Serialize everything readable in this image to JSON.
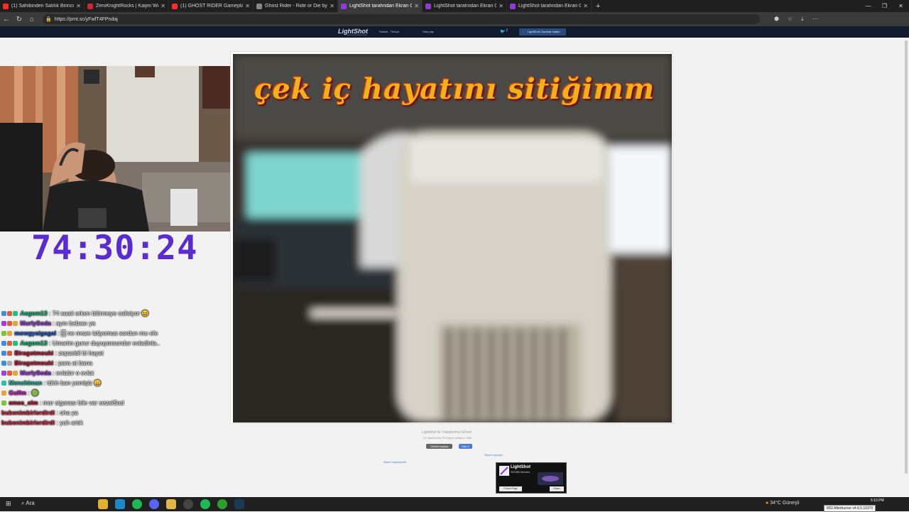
{
  "browser": {
    "tabs": [
      {
        "title": "(1) Sahibinden Satılık Birinci El Ot",
        "color": "#ff2b2b"
      },
      {
        "title": "ZeroKnightRocks | Kaijini Wiki | Fa",
        "color": "#d3243b"
      },
      {
        "title": "(1) GHOST RIDER Gameplay Walk",
        "color": "#ff2b2b"
      },
      {
        "title": "Ghost Rider - Ride or Die by Mag",
        "color": "#888888"
      },
      {
        "title": "LightShot tarafından Ekran Görün",
        "color": "#8f3bd6",
        "active": true
      },
      {
        "title": "LightShot tarafından Ekran Görün",
        "color": "#8f3bd6"
      },
      {
        "title": "LightShot tarafından Ekran Görün",
        "color": "#8f3bd6"
      }
    ],
    "url": "https://prnt.sc/yFwfT4FPndaj",
    "new_tab": "+",
    "window_controls": [
      "—",
      "❐",
      "✕"
    ]
  },
  "site": {
    "logo": "LightShot",
    "logo_sub": "ekran görüntüsü aracı",
    "nav": [
      "Türkish - Türkçe",
      "Giriş yap"
    ],
    "social": [
      "🐦",
      "f"
    ],
    "download_button": "LightShot'ı ücretsiz indirin"
  },
  "overlay": {
    "timer": "74:30:24",
    "chat": [
      {
        "user": "Aegom13",
        "user_color": "#1bc47d",
        "text": ": 74 saati erken bitirmeye calisiyor 😆"
      },
      {
        "user": "MurlySoda",
        "user_color": "#9a40e0",
        "text": ": aynı babası ya"
      },
      {
        "user": "mowgyaigagal",
        "user_color": "#2d5fd0",
        "text": ": 🀫 ne meze istiyomus sordun mu efe"
      },
      {
        "user": "Aegom13",
        "user_color": "#1bc47d",
        "text": ": Umarim gurur duyuyorsundur evladinla..",
        "wrap": true
      },
      {
        "user": "Biragotmouki",
        "user_color": "#c0203a",
        "text": ": zepzebil bi hayat"
      },
      {
        "user": "Biragotmouki",
        "user_color": "#c0203a",
        "text": ": para at bana"
      },
      {
        "user": "MurlySoda",
        "user_color": "#9a40e0",
        "text": ": evlattır o evlat"
      },
      {
        "user": "Menchiman",
        "user_color": "#28c0a8",
        "text": ": tühh ban yemişiz 😄"
      },
      {
        "user": "Gulfm",
        "user_color": "#d01fd0",
        "text": ": 🟢"
      },
      {
        "user": "emes_elm",
        "user_color": "#c0203a",
        "text": ": mor sigarası bile var sezaiSad"
      },
      {
        "user": "bubenimbirlerdirdi",
        "user_color": "#d0304a",
        "text": ": oha ya"
      },
      {
        "user": "bubenimbirlerdirdi",
        "user_color": "#d0304a",
        "text": ": yuh artık"
      }
    ]
  },
  "screenshot": {
    "caption": "çek iç hayatını sitiğimm"
  },
  "page_footer": {
    "share_title": "Lightshot ile Yakalanmış Görsel",
    "share_sub": "22 alanlarında 30 milyon kullanıcı aittir",
    "share_button": "Görseli paylaş",
    "like_button": "Like 0",
    "report": "Report inappropriate",
    "report2": "Report copyright"
  },
  "ad": {
    "name": "LightShot",
    "followers": "393,856 followers",
    "follow": "Follow Page",
    "share": "Share"
  },
  "taskbar": {
    "search": "Ara",
    "weather": "34°C  Güneşli",
    "time": "5:10 PM",
    "tooltip": "MSI Afterburner v4.6.5.16370"
  }
}
